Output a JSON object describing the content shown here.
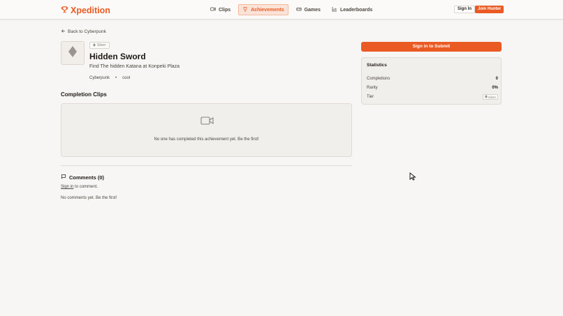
{
  "brand": {
    "name": "Xpedition",
    "color": "#ea5a23"
  },
  "nav": [
    {
      "label": "Clips",
      "icon": "video-icon",
      "active": false
    },
    {
      "label": "Achievements",
      "icon": "trophy-icon",
      "active": true
    },
    {
      "label": "Games",
      "icon": "gamepad-icon",
      "active": false
    },
    {
      "label": "Leaderboards",
      "icon": "bar-chart-icon",
      "active": false
    }
  ],
  "auth": {
    "signin_label": "Sign In",
    "join_label": "Join Hunter"
  },
  "back_link": "Back to Cyberpunk",
  "achievement": {
    "tier": "Silver",
    "title": "Hidden Sword",
    "description": "Find The hidden Katana at Konpeki Plaza",
    "game": "Cyberpunk",
    "separator": "•",
    "tag": "cool"
  },
  "clips": {
    "heading": "Completion Clips",
    "empty_text": "No one has completed this achievement yet. Be the first!"
  },
  "comments": {
    "heading": "Comments (0)",
    "signin_link": "Sign in",
    "signin_suffix": " to comment.",
    "empty_text": "No comments yet. Be the first!"
  },
  "sidebar": {
    "submit_label": "Sign in to Submit",
    "stats_title": "Statistics",
    "completions_label": "Completions",
    "completions_value": "0",
    "rarity_label": "Rarity",
    "rarity_value": "0%",
    "tier_label": "Tier",
    "tier_value": "Silver"
  }
}
